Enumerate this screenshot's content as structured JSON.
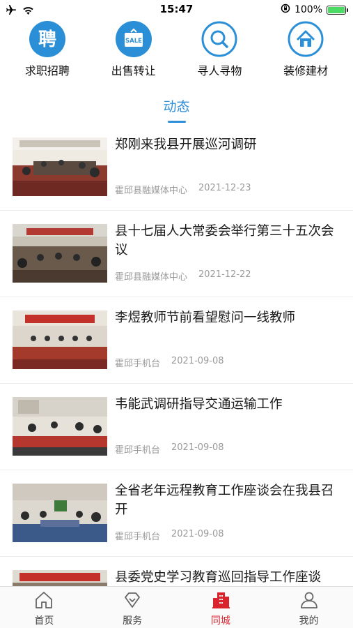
{
  "status_bar": {
    "time": "15:47",
    "battery_percent": "100%",
    "battery_level": 1.0
  },
  "categories": [
    {
      "label": "求职招聘",
      "icon": "recruit-icon",
      "glyph": "聘",
      "color": "#2a8fd6"
    },
    {
      "label": "出售转让",
      "icon": "sale-icon",
      "glyph": "SALE",
      "color": "#2a8fd6"
    },
    {
      "label": "寻人寻物",
      "icon": "search-icon",
      "color": "#2a8fd6"
    },
    {
      "label": "装修建材",
      "icon": "home-icon",
      "color": "#2a8fd6"
    }
  ],
  "section": {
    "title": "动态",
    "accent": "#2e8fd8"
  },
  "news": [
    {
      "title": "郑刚来我县开展巡河调研",
      "source": "霍邱县融媒体中心",
      "date": "2021-12-23"
    },
    {
      "title": "县十七届人大常委会举行第三十五次会议",
      "source": "霍邱县融媒体中心",
      "date": "2021-12-22"
    },
    {
      "title": "李煜教师节前看望慰问一线教师",
      "source": "霍邱手机台",
      "date": "2021-09-08"
    },
    {
      "title": "韦能武调研指导交通运输工作",
      "source": "霍邱手机台",
      "date": "2021-09-08"
    },
    {
      "title": "全省老年远程教育工作座谈会在我县召开",
      "source": "霍邱手机台",
      "date": "2021-09-08"
    },
    {
      "title": "县委党史学习教育巡回指导工作座谈",
      "source": "",
      "date": ""
    }
  ],
  "tabs": [
    {
      "label": "首页",
      "icon": "home-tab-icon",
      "active": false
    },
    {
      "label": "服务",
      "icon": "service-tab-icon",
      "active": false
    },
    {
      "label": "同城",
      "icon": "city-tab-icon",
      "active": true
    },
    {
      "label": "我的",
      "icon": "profile-tab-icon",
      "active": false
    }
  ],
  "colors": {
    "active_tab": "#d9232d",
    "accent": "#2e8fd8",
    "meta_text": "#9a9a9a"
  }
}
